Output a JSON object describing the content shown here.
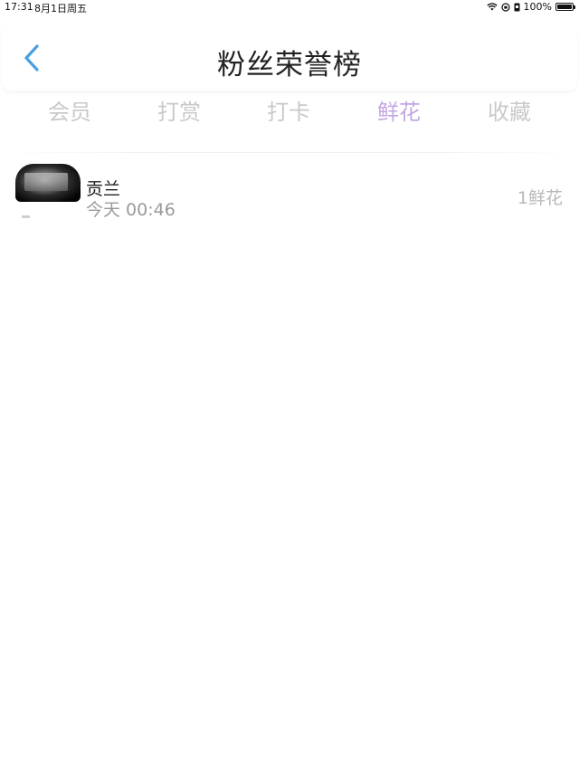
{
  "status_bar": {
    "time": "17:31",
    "date": "8月1日周五",
    "battery": "100%"
  },
  "header": {
    "title": "粉丝荣誉榜",
    "back_icon": "chevron-left-icon",
    "accent_color": "#4a9fe0"
  },
  "tabs": [
    {
      "label": "会员",
      "active": false
    },
    {
      "label": "打赏",
      "active": false
    },
    {
      "label": "打卡",
      "active": false
    },
    {
      "label": "鲜花",
      "active": true
    },
    {
      "label": "收藏",
      "active": false
    }
  ],
  "colors": {
    "tab_active": "#c3a6e3",
    "tab_inactive": "#c9c9c9"
  },
  "fans": [
    {
      "name": "贡兰",
      "time": "今天 00:46",
      "value": "1鲜花"
    }
  ]
}
